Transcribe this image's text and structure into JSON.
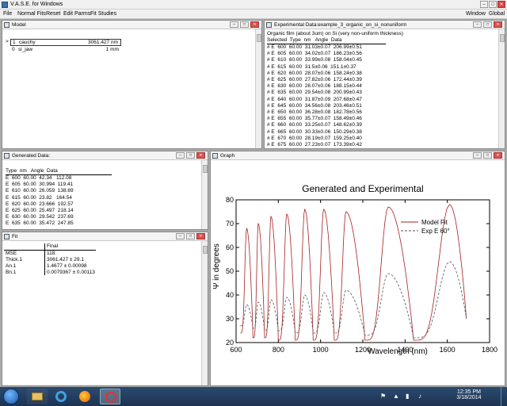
{
  "app": {
    "title": "V.A.S.E. for Windows",
    "menu": [
      "File",
      "Normal Fits",
      "Reset",
      "Edit Parms",
      "Fit Studies"
    ],
    "menu_right": [
      "Window",
      "Global"
    ]
  },
  "model_panel": {
    "title": "Model",
    "layers": [
      {
        "index": "1",
        "name": "cauchy",
        "value": "3061.427 nm"
      },
      {
        "index": "0",
        "name": "si_jaw",
        "value": "1 mm"
      }
    ]
  },
  "exp_panel": {
    "title": "Experimental Data:example_3_organic_on_si_nonuniform",
    "subtitle": "Organic film (about 3um) on Si (very non-uniform thickness)",
    "header": "Selected  Type  nm   Angle  Data",
    "rows": [
      "# E  600  60.00  31.03±0.07  206.99±0.51",
      "# E  605  60.00  34.02±0.07  186.23±0.56",
      "# E  610  60.00  33.99±0.08  158.04±0.45",
      "# E  615  60.00  31.5±0.06  151.1±0.37",
      "# E  620  60.00  28.07±0.06  158.24±0.38",
      "# E  625  60.00  27.82±0.06  172.44±0.39",
      "# E  630  60.00  28.07±0.06  188.15±0.44",
      "# E  635  60.00  29.54±0.08  200.99±0.43",
      "# E  640  60.00  31.87±0.09  207.68±0.47",
      "# E  645  60.00  34.56±0.08  203.46±0.51",
      "# E  650  60.00  36.28±0.08  182.78±0.56",
      "# E  655  60.00  35.77±0.07  158.49±0.46",
      "# E  660  60.00  33.25±0.07  148.62±0.39",
      "# E  665  60.00  30.33±0.06  150.29±0.38",
      "# E  670  60.00  28.19±0.07  159.25±0.40",
      "# E  675  60.00  27.23±0.07  173.39±0.42"
    ]
  },
  "gen_panel": {
    "title": "Generated Data:",
    "header": "Type  nm   Angle  Data",
    "rows": [
      "E  600  60.00  42.34   112.08",
      "E  605  60.00  30.994  119.41",
      "E  610  60.00  26.059  138.69",
      "E  615  60.00  23.82   164.54",
      "E  620  60.00  23.666  192.57",
      "E  625  60.00  25.497  218.14",
      "E  630  60.00  29.542  237.69",
      "E  635  60.00  35.472  247.85"
    ]
  },
  "fit_panel": {
    "title": "Fit",
    "col_header": "Final",
    "rows": [
      {
        "label": "MSE",
        "value": "118."
      },
      {
        "label": "Thick.1",
        "value": "3061.427 ± 29.1"
      },
      {
        "label": "An.1",
        "value": "1.4677 ± 0.00098"
      },
      {
        "label": "Bn.1",
        "value": "0.0079367 ± 0.00113"
      }
    ]
  },
  "graph_panel": {
    "title": "Graph"
  },
  "chart_data": {
    "type": "line",
    "title": "Generated and Experimental",
    "xlabel": "Wavelength (nm)",
    "ylabel": "Ψ in degrees",
    "xlim": [
      600,
      1800
    ],
    "ylim": [
      20,
      80
    ],
    "xticks": [
      600,
      800,
      1000,
      1200,
      1400,
      1600,
      1800
    ],
    "yticks": [
      20,
      30,
      40,
      50,
      60,
      70,
      80
    ],
    "legend_position": "top-right",
    "series": [
      {
        "name": "Model Fit",
        "color": "#a52020",
        "style": "solid",
        "peaks": [
          [
            650,
            68
          ],
          [
            705,
            70
          ],
          [
            765,
            73
          ],
          [
            840,
            74
          ],
          [
            925,
            76
          ],
          [
            1015,
            76
          ],
          [
            1120,
            75
          ],
          [
            1320,
            77
          ],
          [
            1610,
            78
          ]
        ],
        "valleys": [
          [
            620,
            24
          ],
          [
            680,
            22
          ],
          [
            735,
            22
          ],
          [
            800,
            21
          ],
          [
            880,
            21
          ],
          [
            965,
            21
          ],
          [
            1065,
            21
          ],
          [
            1210,
            21
          ],
          [
            1440,
            21
          ],
          [
            1690,
            30
          ]
        ]
      },
      {
        "name": "Exp E 60°",
        "color": "#555555",
        "style": "dashed",
        "peaks": [
          [
            650,
            36
          ],
          [
            705,
            37
          ],
          [
            765,
            38
          ],
          [
            840,
            39
          ],
          [
            925,
            40
          ],
          [
            1015,
            41
          ],
          [
            1120,
            42
          ],
          [
            1320,
            49
          ],
          [
            1610,
            54
          ]
        ],
        "valleys": [
          [
            620,
            27
          ],
          [
            680,
            26
          ],
          [
            735,
            25
          ],
          [
            800,
            25
          ],
          [
            880,
            24
          ],
          [
            965,
            24
          ],
          [
            1065,
            24
          ],
          [
            1210,
            23
          ],
          [
            1440,
            22
          ],
          [
            1690,
            30
          ]
        ]
      }
    ]
  },
  "taskbar": {
    "time": "12:35 PM",
    "date": "3/18/2014"
  }
}
